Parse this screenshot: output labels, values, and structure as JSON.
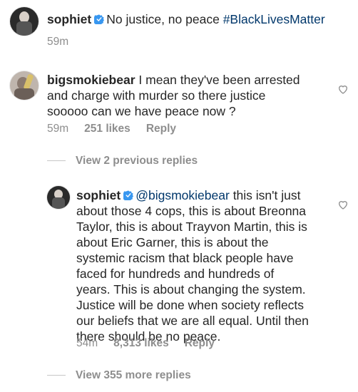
{
  "post": {
    "username": "sophiet",
    "caption": "No justice, no peace",
    "hashtag": "#BlackLivesMatter",
    "time": "59m"
  },
  "comment": {
    "username": "bigsmokiebear",
    "text_lines": [
      "I mean they've been arrested",
      "and charge with murder so there justice",
      "sooooo can we have peace now ?"
    ],
    "time": "59m",
    "likes": "251 likes",
    "reply_label": "Reply",
    "view_previous": "View 2 previous replies"
  },
  "reply": {
    "username": "sophiet",
    "mention": "@bigsmokiebear",
    "first_line_text": "this isn't just",
    "text_lines": [
      "about those 4 cops, this is about Breonna",
      "Taylor, this is about Trayvon Martin, this is",
      "about Eric Garner, this is about the",
      "systemic racism that black people have",
      "faced for hundreds and hundreds of",
      "years. This is about changing the system.",
      "Justice will be done when society reflects",
      "our beliefs that we are all equal. Until then",
      "there should be no peace."
    ],
    "time": "54m",
    "likes": "8,313 likes",
    "reply_label": "Reply",
    "view_more": "View 355 more replies"
  },
  "icons": {
    "verified": "verified-badge-icon",
    "heart": "heart-outline-icon"
  },
  "colors": {
    "verified": "#3897f0",
    "link": "#00376b",
    "meta": "#8e8e8e"
  }
}
